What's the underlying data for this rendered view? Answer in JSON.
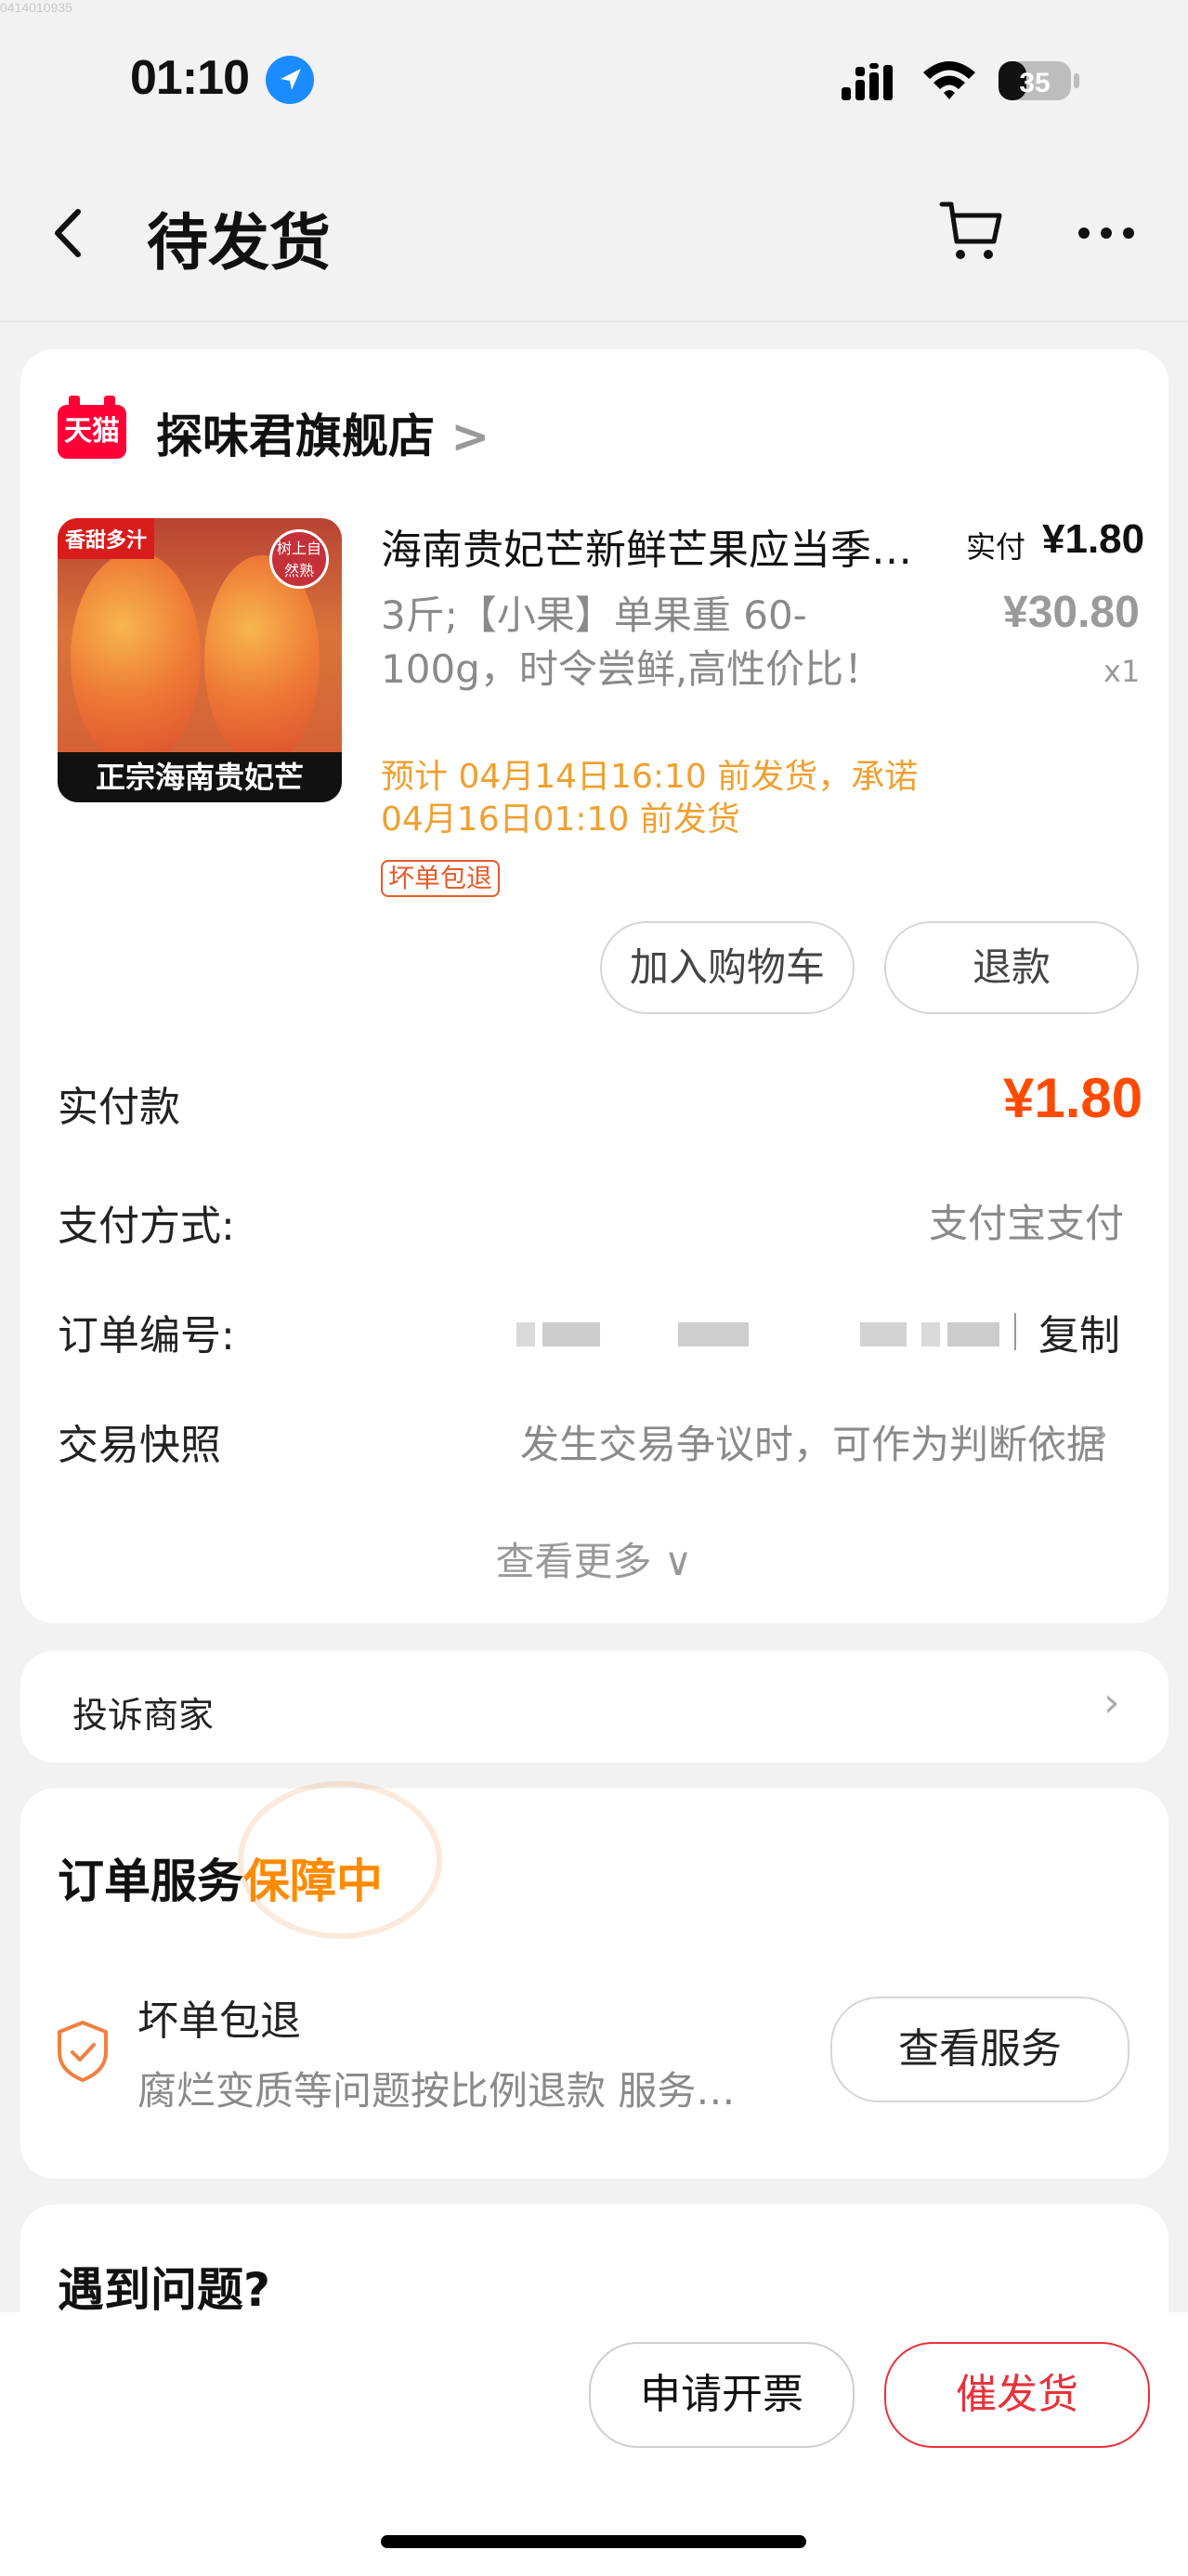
{
  "watermark": "0414010935",
  "status_bar": {
    "time": "01:10",
    "battery": "35"
  },
  "nav": {
    "title": "待发货"
  },
  "store": {
    "badge": "天猫",
    "name": "探味君旗舰店",
    "chevron": ">"
  },
  "product": {
    "image": {
      "tag": "香甜多汁",
      "badge": "树上自然熟",
      "banner": "正宗海南贵妃芒"
    },
    "title": "海南贵妃芒新鲜芒果应当季水果",
    "spec": "3斤;【小果】单果重 60-100g，时令尝鲜,高性价比！",
    "eta": "预计 04月14日16:10 前发货，承诺04月16日01:10 前发货",
    "tag": "坏单包退",
    "paid_label": "实付",
    "paid_value": "¥1.80",
    "original_price": "¥30.80",
    "quantity": "x1"
  },
  "actions": {
    "add_cart": "加入购物车",
    "refund": "退款"
  },
  "order": {
    "total_label": "实付款",
    "total_value": "¥1.80",
    "pay_method_label": "支付方式:",
    "pay_method_value": "支付宝支付",
    "order_no_label": "订单编号:",
    "copy_label": "复制",
    "snapshot_label": "交易快照",
    "snapshot_value": "发生交易争议时，可作为判断依据",
    "view_more": "查看更多 ∨"
  },
  "complaint": {
    "label": "投诉商家"
  },
  "service": {
    "title": "订单服务",
    "highlight": "保障中",
    "item_name": "坏单包退",
    "item_desc": "腐烂变质等问题按比例退款  服务由商家提供",
    "view_button": "查看服务"
  },
  "problem": {
    "title": "遇到问题?"
  },
  "bottom": {
    "invoice": "申请开票",
    "urge": "催发货"
  },
  "colors": {
    "accent": "#ff4a00",
    "warning": "#f0a030",
    "danger": "#e8323a",
    "tmall": "#ff0036"
  }
}
